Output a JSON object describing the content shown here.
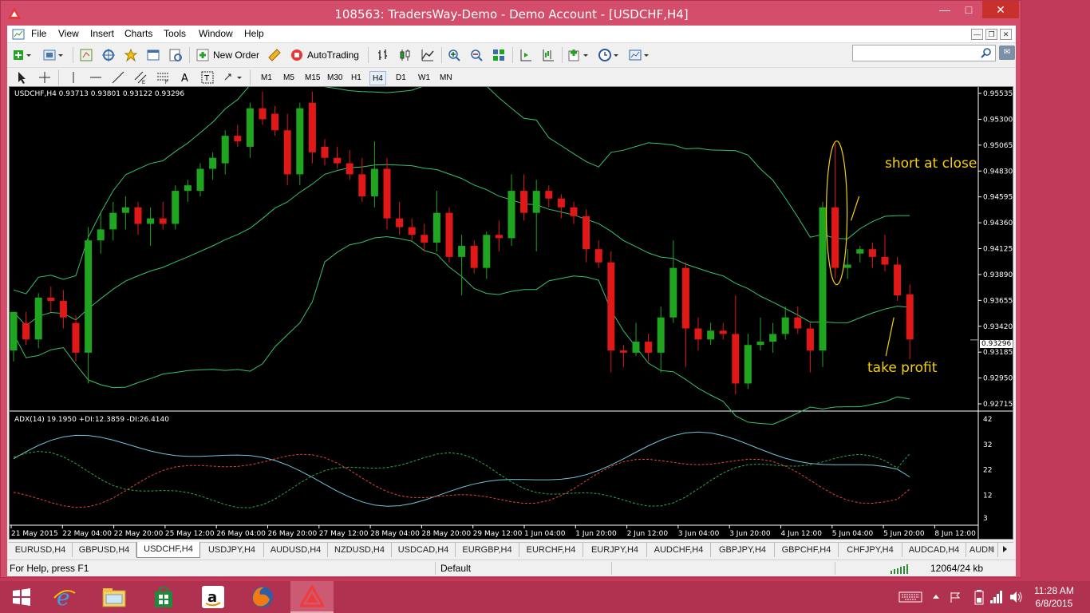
{
  "window": {
    "title": "108563: TradersWay-Demo - Demo Account - [USDCHF,H4]"
  },
  "menu": [
    "File",
    "View",
    "Insert",
    "Charts",
    "Tools",
    "Window",
    "Help"
  ],
  "toolbar": {
    "new_order_label": "New Order",
    "autotrading_label": "AutoTrading"
  },
  "timeframes": [
    "M1",
    "M5",
    "M15",
    "M30",
    "H1",
    "H4",
    "D1",
    "W1",
    "MN"
  ],
  "active_timeframe": "H4",
  "chart": {
    "header": "USDCHF,H4  0.93713 0.93801 0.93122 0.93296",
    "indicator_header": "ADX(14) 19.1950 +DI:12.3859 -DI:26.4140",
    "current_price": "0.93296",
    "price_ticks": [
      "0.95535",
      "0.95300",
      "0.95065",
      "0.94830",
      "0.94595",
      "0.94360",
      "0.94125",
      "0.93890",
      "0.93655",
      "0.93420",
      "0.93185",
      "0.92950",
      "0.92715"
    ],
    "adx_ticks": [
      "42",
      "32",
      "22",
      "12",
      "3"
    ],
    "time_ticks": [
      "21 May 2015",
      "22 May 04:00",
      "22 May 20:00",
      "25 May 12:00",
      "26 May 04:00",
      "26 May 20:00",
      "27 May 12:00",
      "28 May 04:00",
      "28 May 20:00",
      "29 May 12:00",
      "1 Jun 04:00",
      "1 Jun 20:00",
      "2 Jun 12:00",
      "3 Jun 04:00",
      "3 Jun 20:00",
      "4 Jun 12:00",
      "5 Jun 04:00",
      "5 Jun 20:00",
      "8 Jun 12:00"
    ],
    "annotations": {
      "short": "short at close",
      "take_profit": "take profit"
    },
    "colors": {
      "bull": "#1fa51f",
      "bear": "#e01818",
      "bands": "#37c26b",
      "adx": "#6fc3d9",
      "plus_di": "#2aa84a",
      "minus_di": "#e0433c",
      "annotation": "#f5d10a"
    }
  },
  "chart_data": {
    "type": "candlestick",
    "symbol": "USDCHF",
    "timeframe": "H4",
    "ohlc_last": {
      "open": 0.93713,
      "high": 0.93801,
      "low": 0.93122,
      "close": 0.93296
    },
    "ylim": [
      0.92715,
      0.95535
    ],
    "candles": [
      [
        0.932,
        0.9345,
        0.931,
        0.9355
      ],
      [
        0.9345,
        0.9355,
        0.9325,
        0.933
      ],
      [
        0.933,
        0.9372,
        0.9322,
        0.9368
      ],
      [
        0.9368,
        0.9378,
        0.9355,
        0.9365
      ],
      [
        0.9365,
        0.9375,
        0.934,
        0.935
      ],
      [
        0.9345,
        0.9352,
        0.931,
        0.9318
      ],
      [
        0.9318,
        0.9432,
        0.929,
        0.942
      ],
      [
        0.942,
        0.9445,
        0.9408,
        0.943
      ],
      [
        0.943,
        0.9455,
        0.942,
        0.9445
      ],
      [
        0.9445,
        0.946,
        0.943,
        0.945
      ],
      [
        0.945,
        0.9455,
        0.9425,
        0.9435
      ],
      [
        0.9435,
        0.945,
        0.9415,
        0.944
      ],
      [
        0.944,
        0.9455,
        0.943,
        0.9435
      ],
      [
        0.9435,
        0.947,
        0.943,
        0.9465
      ],
      [
        0.9465,
        0.9475,
        0.9455,
        0.947
      ],
      [
        0.9465,
        0.949,
        0.946,
        0.9485
      ],
      [
        0.9485,
        0.95,
        0.9475,
        0.9495
      ],
      [
        0.949,
        0.952,
        0.948,
        0.9515
      ],
      [
        0.9515,
        0.9525,
        0.9505,
        0.951
      ],
      [
        0.9505,
        0.9545,
        0.9495,
        0.954
      ],
      [
        0.954,
        0.9555,
        0.9525,
        0.953
      ],
      [
        0.9535,
        0.9542,
        0.9515,
        0.952
      ],
      [
        0.952,
        0.9535,
        0.947,
        0.948
      ],
      [
        0.948,
        0.9545,
        0.947,
        0.954
      ],
      [
        0.9545,
        0.9555,
        0.949,
        0.95
      ],
      [
        0.9505,
        0.9512,
        0.9488,
        0.9495
      ],
      [
        0.9495,
        0.9505,
        0.9485,
        0.949
      ],
      [
        0.949,
        0.9502,
        0.9475,
        0.948
      ],
      [
        0.948,
        0.9495,
        0.9455,
        0.946
      ],
      [
        0.946,
        0.951,
        0.945,
        0.9485
      ],
      [
        0.9485,
        0.9495,
        0.943,
        0.944
      ],
      [
        0.944,
        0.9455,
        0.9425,
        0.9432
      ],
      [
        0.9432,
        0.944,
        0.942,
        0.9425
      ],
      [
        0.9425,
        0.9435,
        0.941,
        0.9418
      ],
      [
        0.9418,
        0.9465,
        0.941,
        0.9445
      ],
      [
        0.9445,
        0.945,
        0.94,
        0.9405
      ],
      [
        0.9405,
        0.9425,
        0.937,
        0.9415
      ],
      [
        0.9415,
        0.942,
        0.939,
        0.9395
      ],
      [
        0.9395,
        0.9428,
        0.9385,
        0.9425
      ],
      [
        0.9425,
        0.9438,
        0.941,
        0.9422
      ],
      [
        0.9422,
        0.948,
        0.9415,
        0.9465
      ],
      [
        0.9465,
        0.948,
        0.9438,
        0.9445
      ],
      [
        0.9445,
        0.9475,
        0.941,
        0.9465
      ],
      [
        0.9465,
        0.947,
        0.945,
        0.9458
      ],
      [
        0.9458,
        0.9462,
        0.944,
        0.945
      ],
      [
        0.945,
        0.9455,
        0.9435,
        0.9442
      ],
      [
        0.9442,
        0.9448,
        0.94,
        0.9412
      ],
      [
        0.9412,
        0.942,
        0.9395,
        0.94
      ],
      [
        0.94,
        0.941,
        0.93,
        0.932
      ],
      [
        0.932,
        0.9325,
        0.9305,
        0.9318
      ],
      [
        0.9318,
        0.9345,
        0.9315,
        0.9328
      ],
      [
        0.9328,
        0.9335,
        0.931,
        0.9318
      ],
      [
        0.9318,
        0.936,
        0.93,
        0.935
      ],
      [
        0.935,
        0.942,
        0.9345,
        0.9395
      ],
      [
        0.9395,
        0.94,
        0.9305,
        0.934
      ],
      [
        0.934,
        0.935,
        0.932,
        0.933
      ],
      [
        0.933,
        0.9345,
        0.9325,
        0.9338
      ],
      [
        0.9338,
        0.9345,
        0.933,
        0.9335
      ],
      [
        0.9335,
        0.937,
        0.928,
        0.929
      ],
      [
        0.929,
        0.9335,
        0.9285,
        0.9325
      ],
      [
        0.9325,
        0.935,
        0.932,
        0.9328
      ],
      [
        0.9328,
        0.9345,
        0.9318,
        0.9335
      ],
      [
        0.9335,
        0.936,
        0.933,
        0.935
      ],
      [
        0.935,
        0.936,
        0.9335,
        0.934
      ],
      [
        0.934,
        0.9345,
        0.93,
        0.932
      ],
      [
        0.932,
        0.9455,
        0.9305,
        0.945
      ],
      [
        0.945,
        0.9508,
        0.9385,
        0.9395
      ],
      [
        0.9395,
        0.9412,
        0.9385,
        0.9398
      ],
      [
        0.9408,
        0.9415,
        0.94,
        0.9412
      ],
      [
        0.9412,
        0.9418,
        0.9395,
        0.9405
      ],
      [
        0.9405,
        0.9425,
        0.9392,
        0.9398
      ],
      [
        0.9398,
        0.9405,
        0.9365,
        0.937
      ],
      [
        0.9371,
        0.938,
        0.9312,
        0.933
      ]
    ],
    "candle_fields": [
      "open",
      "high",
      "low",
      "close"
    ],
    "indicators": {
      "bollinger": true,
      "adx": {
        "period": 14,
        "adx": 19.195,
        "plus_di": 12.3859,
        "minus_di": 26.414,
        "ylim": [
          3,
          42
        ]
      }
    }
  },
  "symbol_tabs": [
    "EURUSD,H4",
    "GBPUSD,H4",
    "USDCHF,H4",
    "USDJPY,H4",
    "AUDUSD,H4",
    "NZDUSD,H4",
    "USDCAD,H4",
    "EURGBP,H4",
    "EURCHF,H4",
    "EURJPY,H4",
    "AUDCHF,H4",
    "GBPJPY,H4",
    "GBPCHF,H4",
    "CHFJPY,H4",
    "AUDCAD,H4",
    "AUDN"
  ],
  "active_symbol_tab": "USDCHF,H4",
  "status": {
    "help": "For Help, press F1",
    "profile": "Default",
    "traffic": "12064/24 kb"
  },
  "taskbar": {
    "time": "11:28 AM",
    "date": "6/8/2015"
  }
}
